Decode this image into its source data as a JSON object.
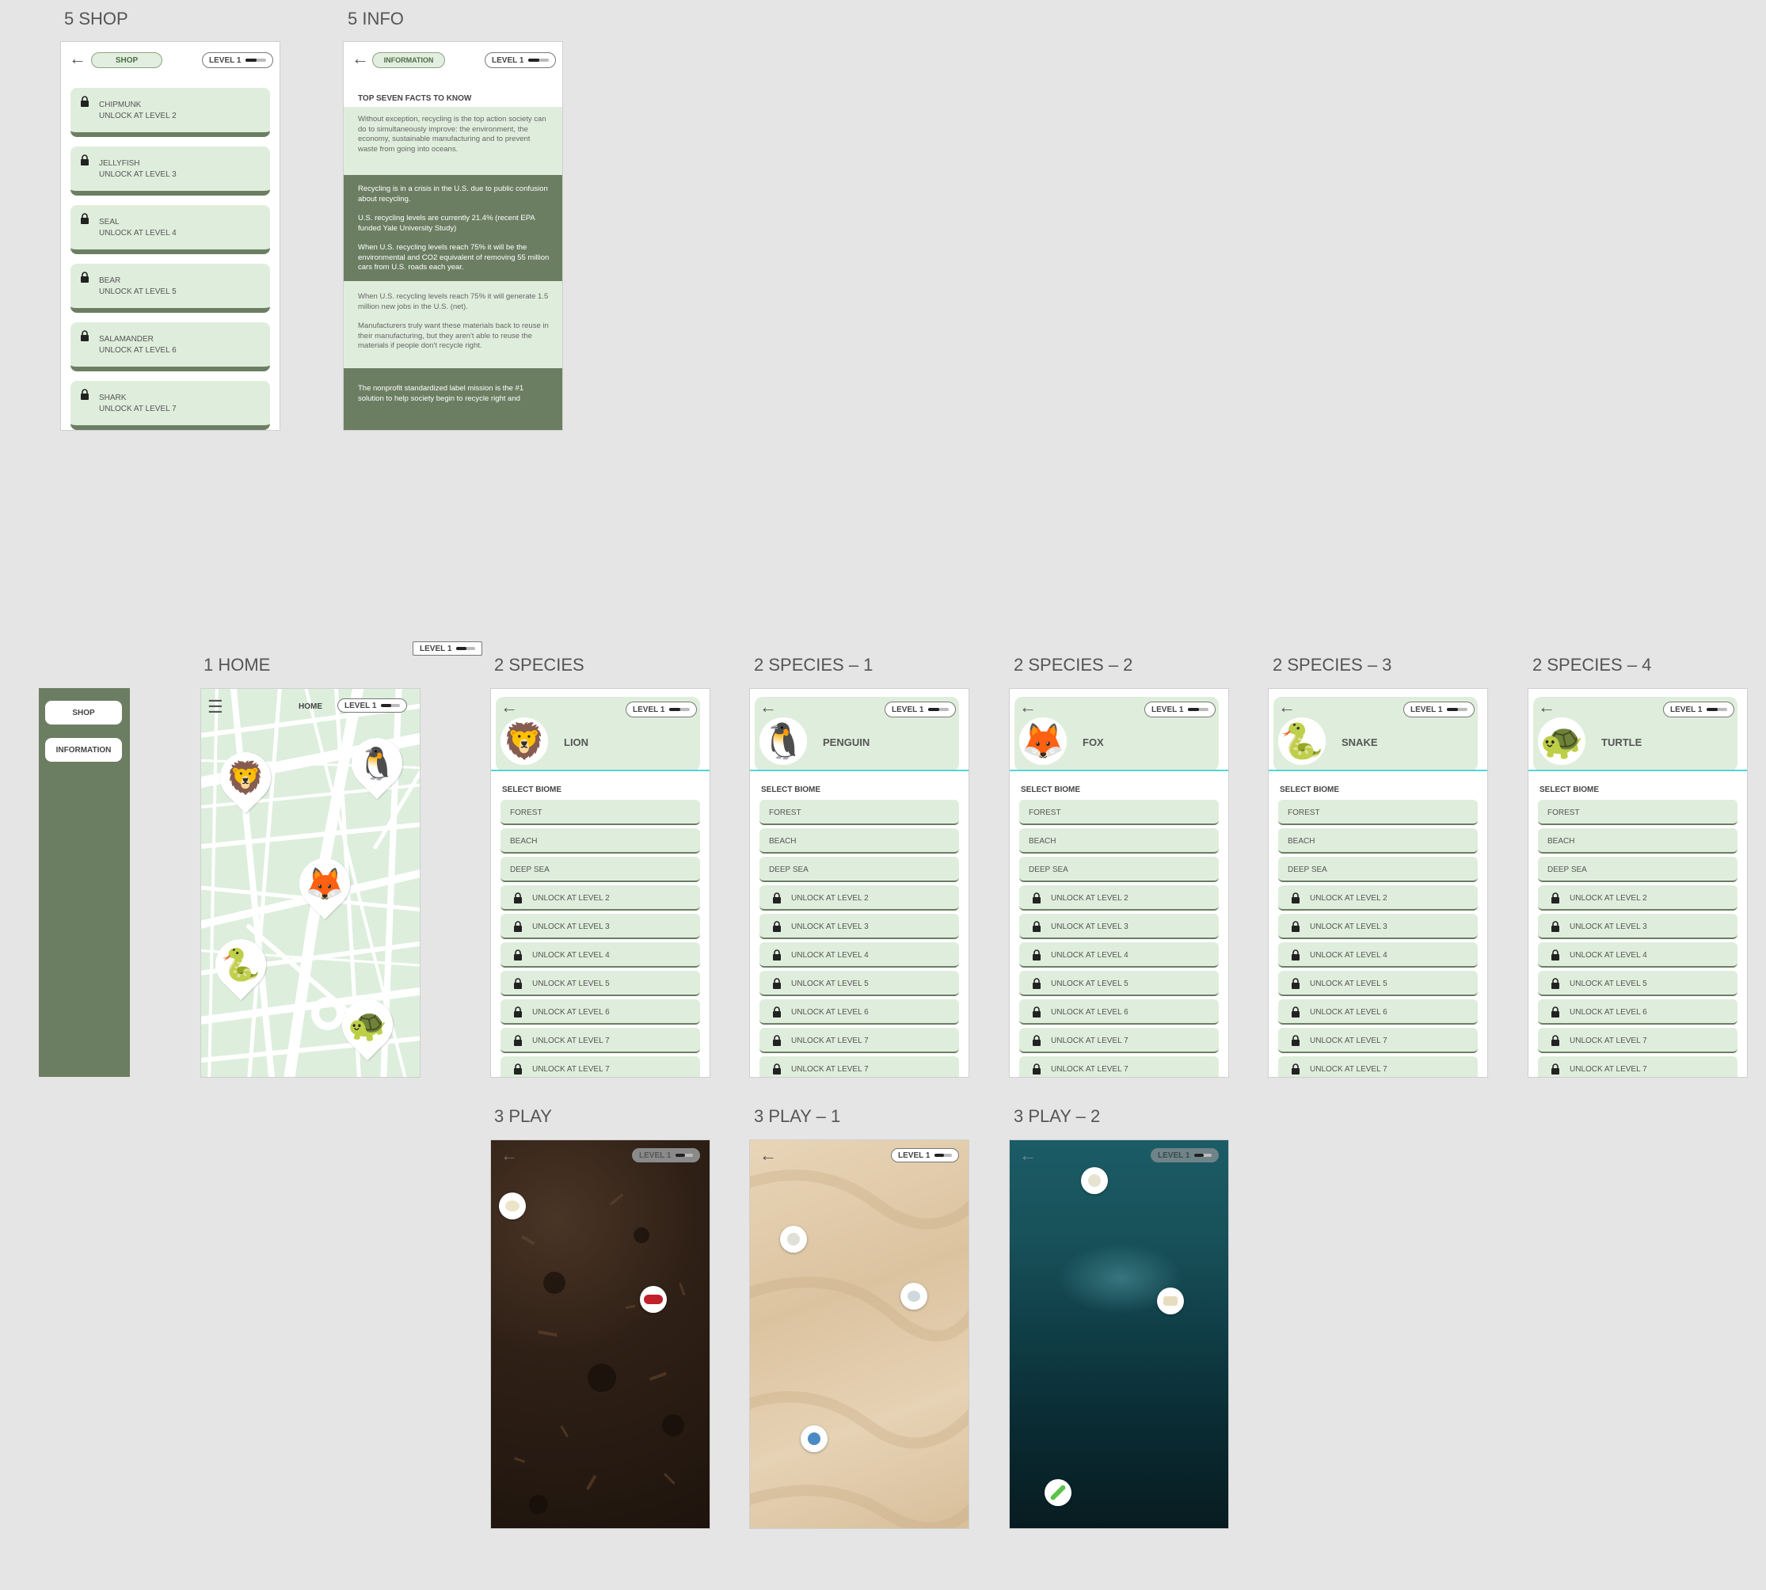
{
  "frames": {
    "shop": "5 SHOP",
    "info": "5 INFO",
    "home": "1 HOME",
    "species": [
      "2 SPECIES",
      "2 SPECIES – 1",
      "2 SPECIES – 2",
      "2 SPECIES – 3",
      "2 SPECIES – 4"
    ],
    "play": [
      "3 PLAY",
      "3 PLAY – 1",
      "3 PLAY – 2"
    ]
  },
  "level_label": "LEVEL 1",
  "back_icon": "←",
  "shop": {
    "pill": "SHOP",
    "items": [
      {
        "name": "CHIPMUNK",
        "unlock": "UNLOCK AT LEVEL 2"
      },
      {
        "name": "JELLYFISH",
        "unlock": "UNLOCK AT LEVEL 3"
      },
      {
        "name": "SEAL",
        "unlock": "UNLOCK AT LEVEL 4"
      },
      {
        "name": "BEAR",
        "unlock": "UNLOCK AT LEVEL 5"
      },
      {
        "name": "SALAMANDER",
        "unlock": "UNLOCK AT LEVEL 6"
      },
      {
        "name": "SHARK",
        "unlock": "UNLOCK AT LEVEL 7"
      }
    ]
  },
  "info": {
    "pill": "INFORMATION",
    "heading": "TOP SEVEN FACTS TO KNOW",
    "p1": "Without exception, recycling is the top action society can do to simultaneously improve: the environment, the economy, sustainable manufacturing and to prevent waste from going into oceans.",
    "p2": "Recycling is in a crisis in the U.S. due to public confusion about recycling.",
    "p3": "U.S. recycling levels are currently 21.4% (recent EPA funded Yale University Study)",
    "p4": "When U.S. recycling levels reach 75% it will be the environmental and CO2 equivalent of removing 55 million cars from U.S. roads each year.",
    "p5": "When U.S. recycling levels reach 75% it will generate 1.5 million new jobs in the U.S. (net).",
    "p6": "Manufacturers truly want these materials back to reuse in their manufacturing, but they aren't able to reuse the materials if people don't recycle right.",
    "p7": "The nonprofit standardized label mission is the #1 solution to help society begin to recycle right and"
  },
  "menu": {
    "shop": "SHOP",
    "information": "INFORMATION"
  },
  "home": {
    "title": "HOME",
    "menu_icon": "☰",
    "pins": [
      "🦁",
      "🐧",
      "🦊",
      "🐍",
      "🐢"
    ]
  },
  "species": [
    {
      "name": "LION",
      "icon": "🦁"
    },
    {
      "name": "PENGUIN",
      "icon": "🐧"
    },
    {
      "name": "FOX",
      "icon": "🦊"
    },
    {
      "name": "SNAKE",
      "icon": "🐍"
    },
    {
      "name": "TURTLE",
      "icon": "🐢"
    }
  ],
  "select_biome": "SELECT BIOME",
  "biomes": [
    "FOREST",
    "BEACH",
    "DEEP SEA"
  ],
  "locked": [
    "UNLOCK AT LEVEL 2",
    "UNLOCK AT LEVEL 3",
    "UNLOCK AT LEVEL 4",
    "UNLOCK AT LEVEL 5",
    "UNLOCK AT LEVEL 6",
    "UNLOCK AT LEVEL 7",
    "UNLOCK AT LEVEL 7"
  ],
  "colors": {
    "panel_green": "#6b7e62",
    "light_green": "#dfeedc",
    "accent_cyan": "#53d6d6"
  }
}
